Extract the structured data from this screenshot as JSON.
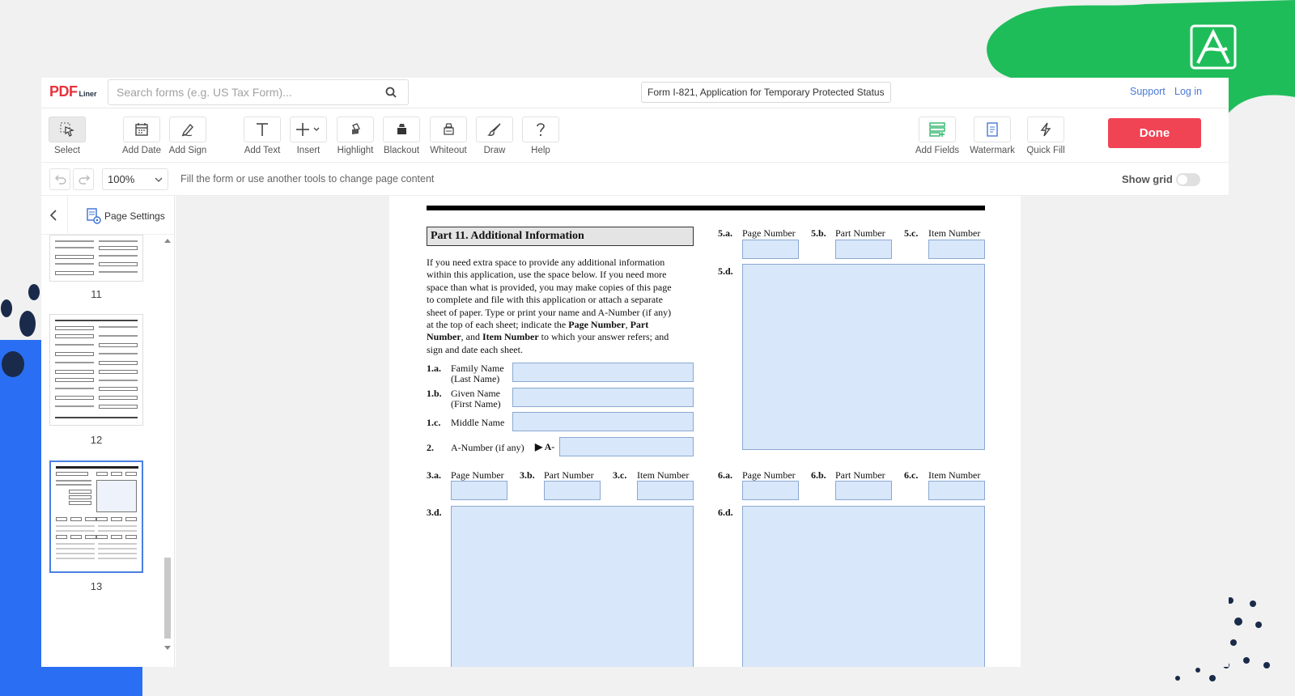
{
  "header": {
    "logo_main": "PDF",
    "logo_sub": "Liner",
    "search_placeholder": "Search forms (e.g. US Tax Form)...",
    "doc_title": "Form I-821, Application for Temporary Protected Status",
    "support": "Support",
    "login": "Log in"
  },
  "toolbar": {
    "tools": [
      {
        "label": "Select",
        "icon": "cursor-icon"
      },
      {
        "label": "Add Date",
        "icon": "calendar-icon"
      },
      {
        "label": "Add Sign",
        "icon": "pen-sign-icon"
      },
      {
        "label": "Add Text",
        "icon": "text-icon"
      },
      {
        "label": "Insert",
        "icon": "plus-icon"
      },
      {
        "label": "Highlight",
        "icon": "highlighter-icon"
      },
      {
        "label": "Blackout",
        "icon": "blackout-icon"
      },
      {
        "label": "Whiteout",
        "icon": "eraser-icon"
      },
      {
        "label": "Draw",
        "icon": "brush-icon"
      },
      {
        "label": "Help",
        "icon": "question-icon"
      },
      {
        "label": "Add Fields",
        "icon": "fields-icon"
      },
      {
        "label": "Watermark",
        "icon": "watermark-icon"
      },
      {
        "label": "Quick Fill",
        "icon": "lightning-icon"
      }
    ],
    "done": "Done"
  },
  "subbar": {
    "zoom": "100%",
    "hint": "Fill the form or use another tools to change page content",
    "show_grid": "Show grid"
  },
  "sidebar": {
    "settings": "Page Settings",
    "pages": [
      "11",
      "12",
      "13"
    ],
    "active_page": "13"
  },
  "form": {
    "part_title": "Part 11.  Additional Information",
    "instructions": [
      "If you need extra space to provide any additional information",
      "within this application, use the space below.  If you need more",
      "space than what is provided, you may make copies of this page",
      "to complete and file with this application or attach a separate",
      "sheet of paper.  Type or print your name and A-Number (if any)",
      "at the top of each sheet; indicate the "
    ],
    "instr_bold_1": "Page Number",
    "instr_sep_1": ", ",
    "instr_bold_2": "Part",
    "instr_bold_3": "Number",
    "instr_mid": ", and ",
    "instr_bold_4": "Item Number",
    "instr_tail_1": " to which your answer refers; and",
    "instr_tail_2": "sign and date each sheet.",
    "n1a": "1.a.",
    "n1a_label_1": "Family Name",
    "n1a_label_2": "(Last Name)",
    "n1b": "1.b.",
    "n1b_label_1": "Given Name",
    "n1b_label_2": "(First Name)",
    "n1c": "1.c.",
    "n1c_label": "Middle Name",
    "n2": "2.",
    "n2_label": "A-Number (if any)",
    "n2_prefix": "▶ A-",
    "n3a": "3.a.",
    "n3b": "3.b.",
    "n3c": "3.c.",
    "n3d": "3.d.",
    "n5a": "5.a.",
    "n5b": "5.b.",
    "n5c": "5.c.",
    "n5d": "5.d.",
    "n6a": "6.a.",
    "n6b": "6.b.",
    "n6c": "6.c.",
    "n6d": "6.d.",
    "page_number": "Page Number",
    "part_number": "Part Number",
    "item_number": "Item Number"
  }
}
